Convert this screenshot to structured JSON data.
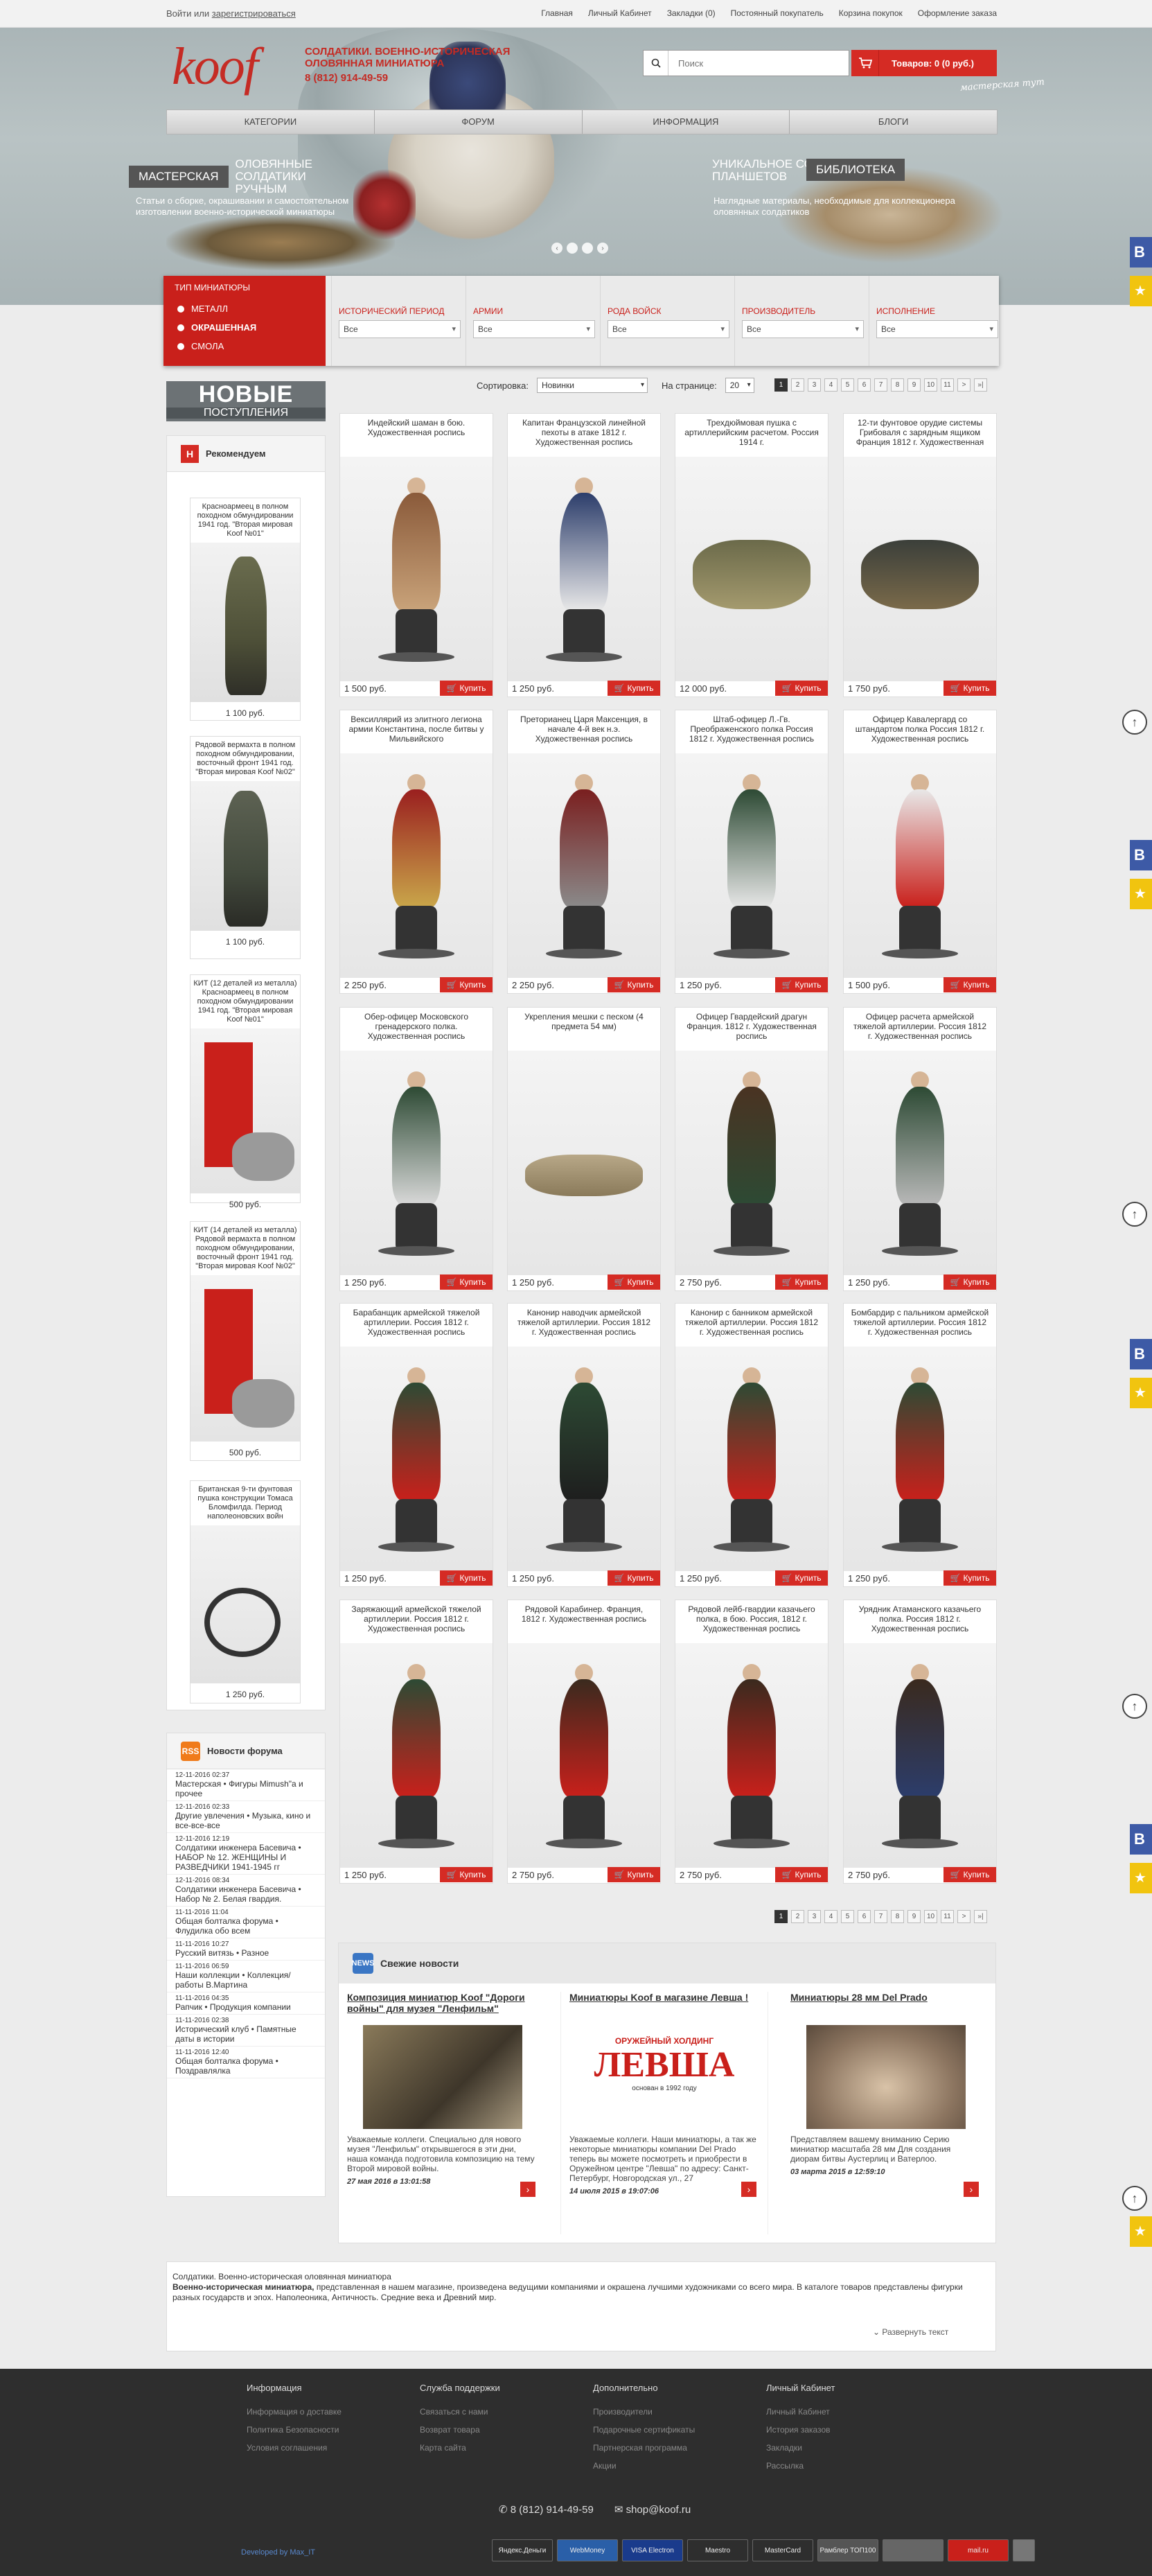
{
  "topbar": {
    "login": "Войти",
    "or": "или",
    "register": "зарегистрироваться",
    "nav": [
      "Главная",
      "Личный Кабинет",
      "Закладки (0)",
      "Постоянный покупатель",
      "Корзина покупок",
      "Оформление заказа"
    ]
  },
  "header": {
    "logo": "koof",
    "tagline": "Солдатики. Военно-историческая оловянная миниатюра",
    "phone": "8 (812) 914-49-59",
    "search_placeholder": "Поиск",
    "cart": "Товаров: 0 (0 руб.)",
    "handnote": "мастерская тут"
  },
  "menu": [
    "Категории",
    "Форум",
    "Информация",
    "Блоги"
  ],
  "promo": {
    "left_title": "Мастерская",
    "left_sub": "оловянные солдатики ручным",
    "left_text": "Статьи о сборке, окрашивании и самостоятельном изготовлении военно-исторической миниатюры",
    "right_title": "Уникальное собрание планшетов",
    "right_badge": "библиотека",
    "right_text": "Наглядные материалы, необходимые для коллекционера оловянных солдатиков",
    "dots": [
      "‹",
      "",
      "",
      "›"
    ]
  },
  "filters": {
    "types_header": "Тип миниатюры",
    "types": [
      "Металл",
      "Окрашенная",
      "Смола"
    ],
    "columns": [
      {
        "label": "Исторический период",
        "value": "Все"
      },
      {
        "label": "Армии",
        "value": "Все"
      },
      {
        "label": "Рода войск",
        "value": "Все"
      },
      {
        "label": "Производитель",
        "value": "Все"
      },
      {
        "label": "Исполнение",
        "value": "Все"
      }
    ]
  },
  "sidebar": {
    "new_a": "НОВЫЕ",
    "new_b": "ПОСТУПЛЕНИЯ",
    "rec_title": "Рекомендуем",
    "hits": "HITS",
    "rec_items": [
      {
        "title": "Красноармеец в полном походном обмундировании 1941 год. \"Вторая мировая Koof №01\"",
        "price": "1 100 руб."
      },
      {
        "title": "Рядовой вермахта в полном походном обмундировании, восточный фронт 1941 год. \"Вторая мировая Koof №02\"",
        "price": "1 100 руб."
      },
      {
        "title": "КИТ (12 деталей из металла) Красноармеец в полном походном обмундировании 1941 год. \"Вторая мировая Koof №01\"",
        "price": "500 руб."
      },
      {
        "title": "КИТ (14 деталей из металла) Рядовой вермахта в полном походном обмундировании, восточный фронт 1941 год. \"Вторая мировая Koof №02\"",
        "price": "500 руб."
      },
      {
        "title": "Британская 9-ти фунтовая пушка конструкции Томаса Бломфилда. Период наполеоновских войн",
        "price": "1 250 руб."
      }
    ],
    "forum_title": "Новости форума",
    "rss": "RSS",
    "forum_items": [
      {
        "d": "12-11-2016 02:37",
        "t": "Мастерская • Фигуры Mimush\"a и прочее"
      },
      {
        "d": "12-11-2016 02:33",
        "t": "Другие увлечения • Музыка, кино и все-все-все"
      },
      {
        "d": "12-11-2016 12:19",
        "t": "Солдатики инженера Басевича • НАБОР № 12. ЖЕНЩИНЫ И РАЗВЕДЧИКИ 1941-1945 гг"
      },
      {
        "d": "12-11-2016 08:34",
        "t": "Солдатики инженера Басевича • Набор № 2. Белая гвардия."
      },
      {
        "d": "11-11-2016 11:04",
        "t": "Общая болталка форума • Флудилка обо всем"
      },
      {
        "d": "11-11-2016 10:27",
        "t": "Русский витязь • Разное"
      },
      {
        "d": "11-11-2016 06:59",
        "t": "Наши коллекции • Коллекция/работы В.Мартина"
      },
      {
        "d": "11-11-2016 04:35",
        "t": "Рапчик • Продукция компании"
      },
      {
        "d": "11-11-2016 02:38",
        "t": "Исторический клуб • Памятные даты в истории"
      },
      {
        "d": "11-11-2016 12:40",
        "t": "Общая болталка форума • Поздравлялка"
      }
    ]
  },
  "sort": {
    "label": "Сортировка:",
    "value": "Новинки",
    "per_page_label": "На странице:",
    "per_page": "20",
    "pages": [
      "1",
      "2",
      "3",
      "4",
      "5",
      "6",
      "7",
      "8",
      "9",
      "10",
      "11",
      ">",
      "»|"
    ]
  },
  "products": [
    {
      "title": "Индейский шаман в бою. Художественная роспись",
      "price": "1 500 руб.",
      "buy": "Купить"
    },
    {
      "title": "Капитан Французской линейной пехоты в атаке 1812 г. Художественная роспись",
      "price": "1 250 руб.",
      "buy": "Купить"
    },
    {
      "title": "Трехдюймовая пушка с артиллерийским расчетом. Россия 1914 г.",
      "price": "12 000 руб.",
      "buy": "Купить"
    },
    {
      "title": "12-ти фунтовое орудие системы Грибоваля с зарядным ящиком Франция 1812 г. Художественная",
      "price": "1 750 руб.",
      "buy": "Купить"
    },
    {
      "title": "Вексиллярий из элитного легиона армии Константина, после битвы у Мильвийского",
      "price": "2 250 руб.",
      "buy": "Купить"
    },
    {
      "title": "Преторианец Царя Максенция, в начале 4-й век н.э. Художественная роспись",
      "price": "2 250 руб.",
      "buy": "Купить"
    },
    {
      "title": "Штаб-офицер Л.-Гв. Преображенского полка Россия 1812 г. Художественная роспись",
      "price": "1 250 руб.",
      "buy": "Купить"
    },
    {
      "title": "Офицер Кавалергард со штандартом полка Россия 1812 г. Художественная роспись",
      "price": "1 500 руб.",
      "buy": "Купить"
    },
    {
      "title": "Обер-офицер Московского гренадерского полка. Художественная роспись",
      "price": "1 250 руб.",
      "buy": "Купить"
    },
    {
      "title": "Укрепления мешки с песком (4 предмета 54 мм)",
      "price": "1 250 руб.",
      "buy": "Купить"
    },
    {
      "title": "Офицер Гвардейский драгун Франция. 1812 г. Художественная роспись",
      "price": "2 750 руб.",
      "buy": "Купить"
    },
    {
      "title": "Офицер расчета армейской тяжелой артиллерии. Россия 1812 г. Художественная роспись",
      "price": "1 250 руб.",
      "buy": "Купить"
    },
    {
      "title": "Барабанщик армейской тяжелой артиллерии. Россия 1812 г. Художественная роспись",
      "price": "1 250 руб.",
      "buy": "Купить"
    },
    {
      "title": "Канонир наводчик армейской тяжелой артиллерии. Россия 1812 г. Художественная роспись",
      "price": "1 250 руб.",
      "buy": "Купить"
    },
    {
      "title": "Канонир с банником армейской тяжелой артиллерии. Россия 1812 г. Художественная роспись",
      "price": "1 250 руб.",
      "buy": "Купить"
    },
    {
      "title": "Бомбардир с пальником армейской тяжелой артиллерии. Россия 1812 г. Художественная роспись",
      "price": "1 250 руб.",
      "buy": "Купить"
    },
    {
      "title": "Заряжающий армейской тяжелой артиллерии. Россия 1812 г. Художественная роспись",
      "price": "1 250 руб.",
      "buy": "Купить"
    },
    {
      "title": "Рядовой Карабинер. Франция, 1812 г. Художественная роспись",
      "price": "2 750 руб.",
      "buy": "Купить"
    },
    {
      "title": "Рядовой лейб-гвардии казачьего полка, в бою. Россия, 1812 г. Художественная роспись",
      "price": "2 750 руб.",
      "buy": "Купить"
    },
    {
      "title": "Урядник Атаманского казачьего полка. Россия 1812 г. Художественная роспись",
      "price": "2 750 руб.",
      "buy": "Купить"
    }
  ],
  "news": {
    "title": "Свежие новости",
    "icon": "NEWS",
    "items": [
      {
        "t": "Композиция миниатюр Koof \"Дороги войны\" для музея \"Ленфильм\"",
        "txt": "Уважаемые коллеги. Специально для нового музея \"Ленфильм\" открывшегося в эти дни, наша команда подготовила композицию на тему Второй мировой войны.",
        "dt": "27 мая 2016 в 13:01:58"
      },
      {
        "t": "Миниатюры Koof в магазине Левша !",
        "txt": "Уважаемые коллеги. Наши миниатюры, а так же некоторые миниатюры компании Del Prado теперь вы можете посмотреть и приобрести в Оружейном центре \"Левша\" по адресу: Санкт-Петербург, Новгородская ул., 27",
        "dt": "14 июля 2015 в 19:07:06",
        "logo_a": "ОРУЖЕЙНЫЙ ХОЛДИНГ",
        "logo_b": "ЛЕВША",
        "logo_c": "основан в 1992 году"
      },
      {
        "t": "Миниатюры 28 мм Del Prado",
        "txt": "Представляем вашему вниманию Серию миниатюр масштаба 28 мм Для создания диорам битвы Аустерлиц и Ватерлоо.",
        "dt": "03 марта 2015 в 12:59:10"
      }
    ]
  },
  "seo": {
    "line1": "Солдатики. Военно-историческая оловянная миниатюра",
    "line2a": "Военно-историческая миниатюра,",
    "line2b": " представленная в нашем магазине, произведена ведущими компаниями и окрашена лучшими художниками со всего мира. В каталоге товаров представлены фигурки разных государств и эпох. Наполеоника, Античность. Средние века и Древний мир.",
    "expand": "Развернуть текст"
  },
  "footer": {
    "cols": [
      {
        "h": "Информация",
        "l": [
          "Информация о доставке",
          "Политика Безопасности",
          "Условия соглашения"
        ]
      },
      {
        "h": "Служба поддержки",
        "l": [
          "Связаться с нами",
          "Возврат товара",
          "Карта сайта"
        ]
      },
      {
        "h": "Дополнительно",
        "l": [
          "Производители",
          "Подарочные сертификаты",
          "Партнерская программа",
          "Акции"
        ]
      },
      {
        "h": "Личный Кабинет",
        "l": [
          "Личный Кабинет",
          "История заказов",
          "Закладки",
          "Рассылка"
        ]
      }
    ],
    "phone": "8 (812) 914-49-59",
    "email": "shop@koof.ru",
    "dev": "Developed by Max_IT",
    "payments": [
      "Яндекс.Деньги",
      "WebMoney",
      "VISA Electron",
      "Maestro",
      "MasterCard",
      "Рамблер ТОП100",
      "",
      "mail.ru",
      ""
    ]
  }
}
